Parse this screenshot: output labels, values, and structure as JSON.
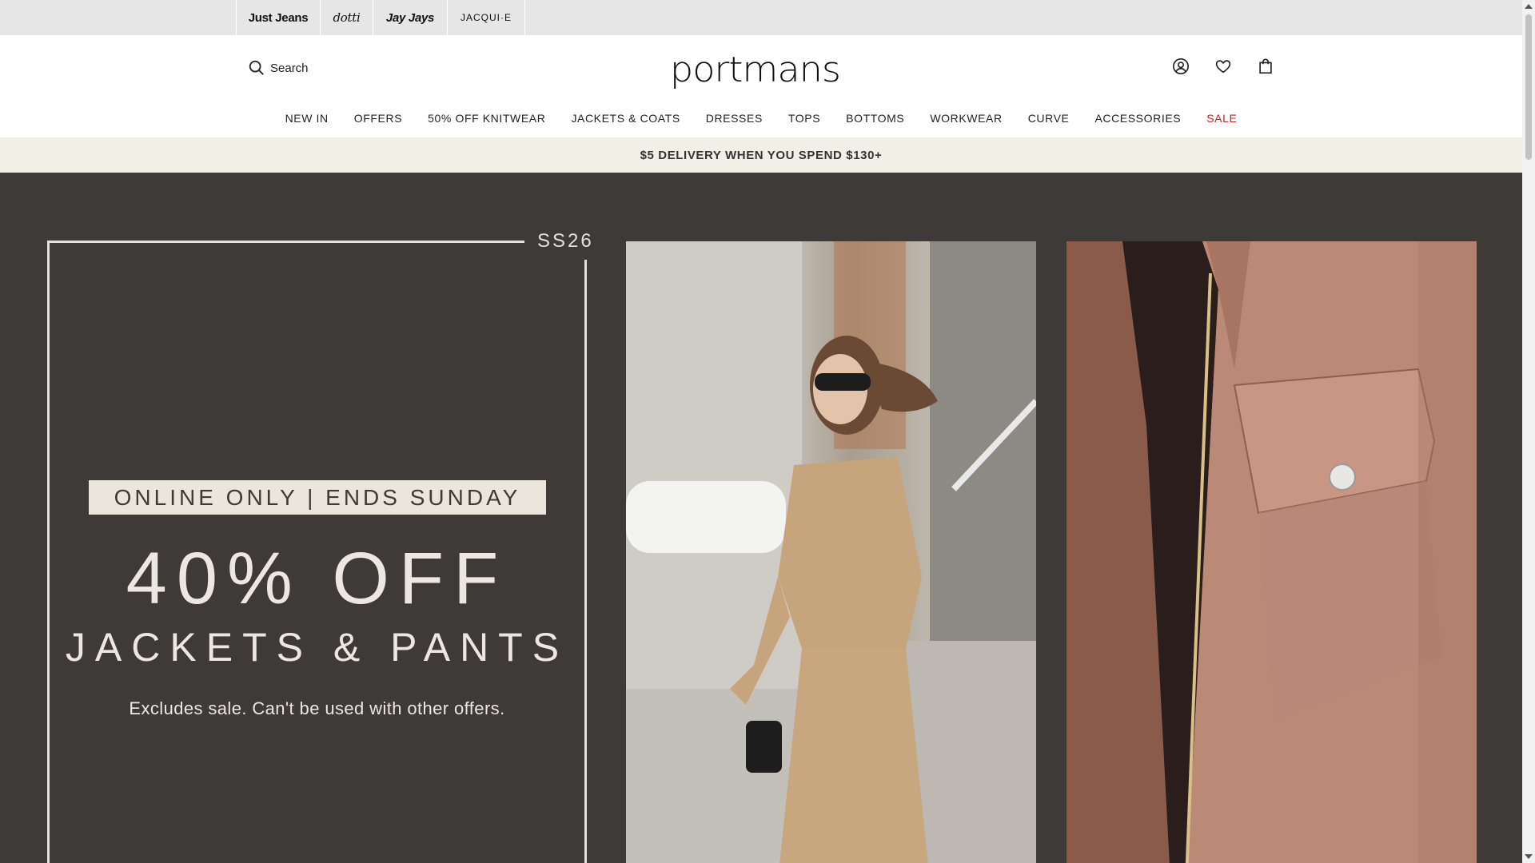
{
  "brands": [
    "Just Jeans",
    "dotti",
    "Jay Jays",
    "JACQUI·E"
  ],
  "header": {
    "search_label": "Search",
    "logo": "portmans",
    "icons": [
      "account-icon",
      "heart-icon",
      "bag-icon"
    ]
  },
  "nav": [
    "NEW IN",
    "OFFERS",
    "50% OFF KNITWEAR",
    "JACKETS & COATS",
    "DRESSES",
    "TOPS",
    "BOTTOMS",
    "WORKWEAR",
    "CURVE",
    "ACCESSORIES",
    "SALE"
  ],
  "promo": "$5 DELIVERY WHEN YOU SPEND $130+",
  "hero": {
    "season": "SS26",
    "badge": "ONLINE ONLY | ENDS SUNDAY",
    "headline": "40% OFF",
    "subhead": "JACKETS & PANTS",
    "note": "Excludes sale. Can't be used with other offers."
  },
  "colors": {
    "brand_bar": "#e6e6e6",
    "promo_bg": "#f1efe6",
    "hero_bg": "#3d3a38",
    "sale": "#c0202a"
  }
}
